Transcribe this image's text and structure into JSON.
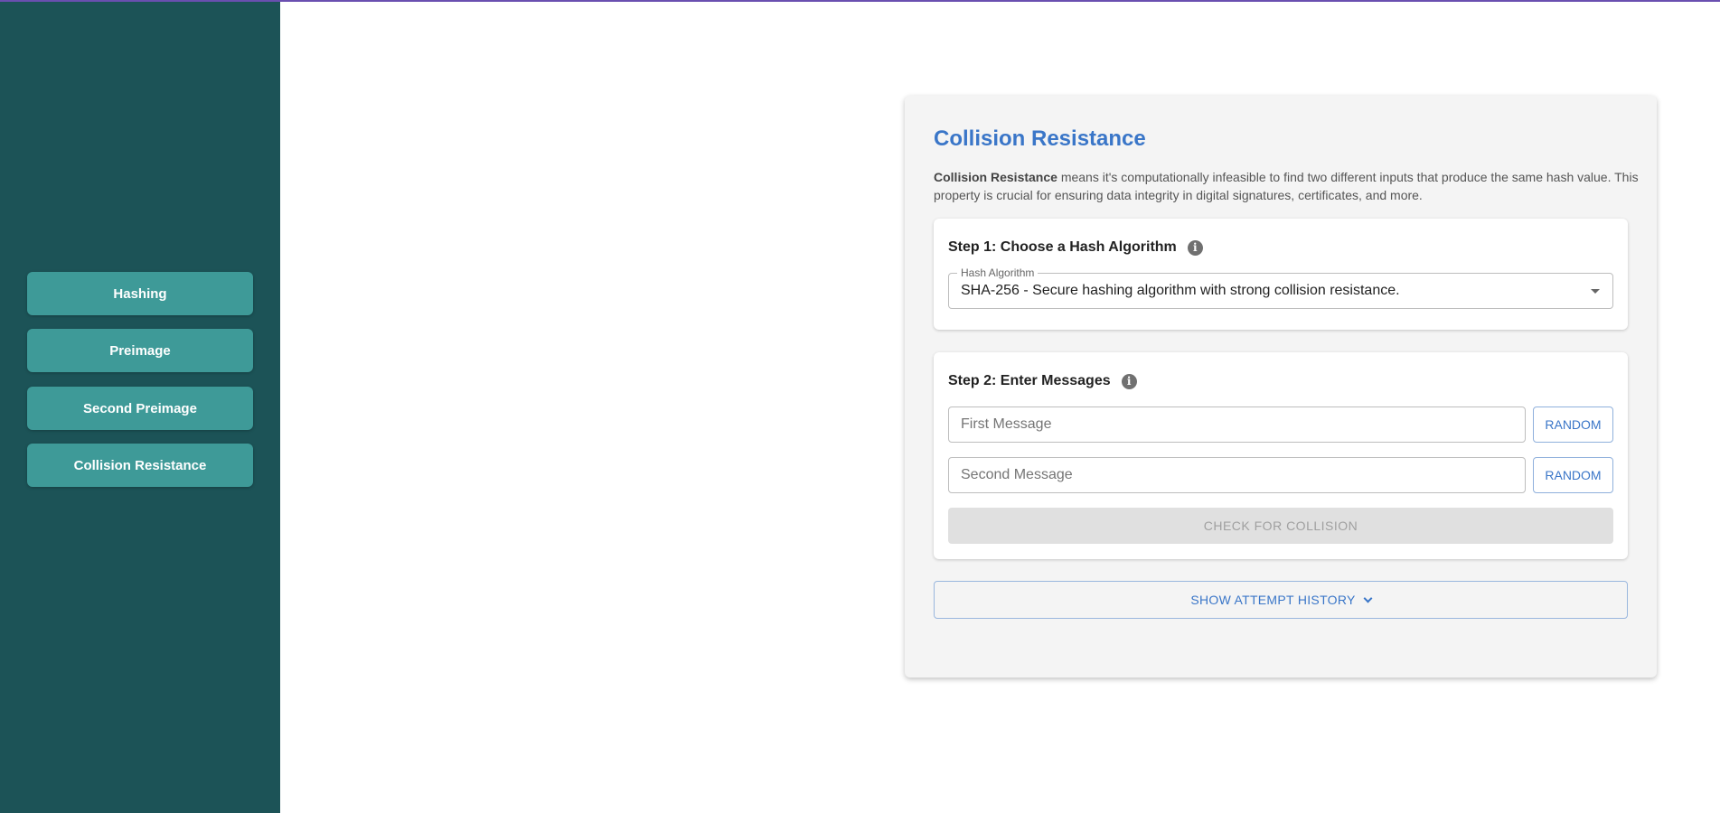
{
  "sidebar": {
    "items": [
      {
        "label": "Hashing"
      },
      {
        "label": "Preimage"
      },
      {
        "label": "Second Preimage"
      },
      {
        "label": "Collision Resistance"
      }
    ]
  },
  "main": {
    "title": "Collision Resistance",
    "description": {
      "term": "Collision Resistance",
      "text": " means it's computationally infeasible to find two different inputs that produce the same hash value. This property is crucial for ensuring data integrity in digital signatures, certificates, and more."
    },
    "step1": {
      "title": "Step 1: Choose a Hash Algorithm",
      "info_icon": "i",
      "select_label": "Hash Algorithm",
      "select_value": "SHA-256 - Secure hashing algorithm with strong collision resistance."
    },
    "step2": {
      "title": "Step 2: Enter Messages",
      "info_icon": "i",
      "first_placeholder": "First Message",
      "second_placeholder": "Second Message",
      "random_label": "RANDOM",
      "check_label": "CHECK FOR COLLISION"
    },
    "history_label": "SHOW ATTEMPT HISTORY"
  },
  "colors": {
    "sidebar_bg": "#1c5357",
    "nav_button": "#3e9a98",
    "accent": "#3a76c8",
    "top_line": "#6a4fb0"
  }
}
